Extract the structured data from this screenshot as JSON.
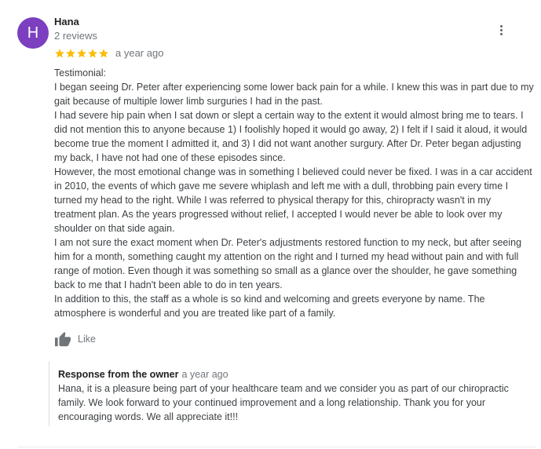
{
  "review": {
    "avatar_letter": "H",
    "avatar_color": "#7b3fc0",
    "reviewer_name": "Hana",
    "review_count": "2 reviews",
    "rating": 5,
    "star_color": "#fbbc04",
    "time_ago": "a year ago",
    "paragraphs": [
      "Testimonial:",
      "I began seeing Dr. Peter after experiencing some lower back pain for a while. I knew this was in part due to my gait because of multiple lower limb surguries I had in the past.",
      "I had severe hip pain when I sat down or slept a certain way to the extent it would almost bring me to tears. I did not mention this to anyone because 1) I foolishly hoped it would go away, 2) I felt if I said it aloud, it would become true the moment I admitted it, and 3) I did not want another surgury. After Dr. Peter began adjusting my back, I have not had one of these episodes since.",
      "However, the most emotional change was in something I believed could never be fixed. I was in a car accident in 2010, the events of which gave me severe whiplash and left me with a dull, throbbing pain every time I turned my head to the right. While I was referred to physical therapy for this, chiropracty wasn't in my treatment plan. As the years progressed without relief, I accepted I would never be able to look over my shoulder on that side again.",
      "I am not sure the exact moment when Dr. Peter's adjustments restored function to my neck, but after seeing him for a month, something caught my attention on the right and I turned my head without pain and with full range of motion. Even though it was something so small as a glance over the shoulder, he gave something back to me that I hadn't been able to do in ten years.",
      "In addition to this, the staff as a whole is so kind and welcoming and greets everyone by name. The atmosphere is wonderful and you are treated like part of a family."
    ],
    "like_label": "Like"
  },
  "response": {
    "title": "Response from the owner",
    "time_ago": "a year ago",
    "text": "Hana, it is a pleasure being part of your healthcare team and we consider you as part of our chiropractic family. We look forward to your continued improvement and a long relationship. Thank you for your encouraging words. We all appreciate it!!!"
  },
  "icons": {
    "more": "more-vert-icon",
    "like": "thumbs-up-icon",
    "star": "star-icon"
  }
}
